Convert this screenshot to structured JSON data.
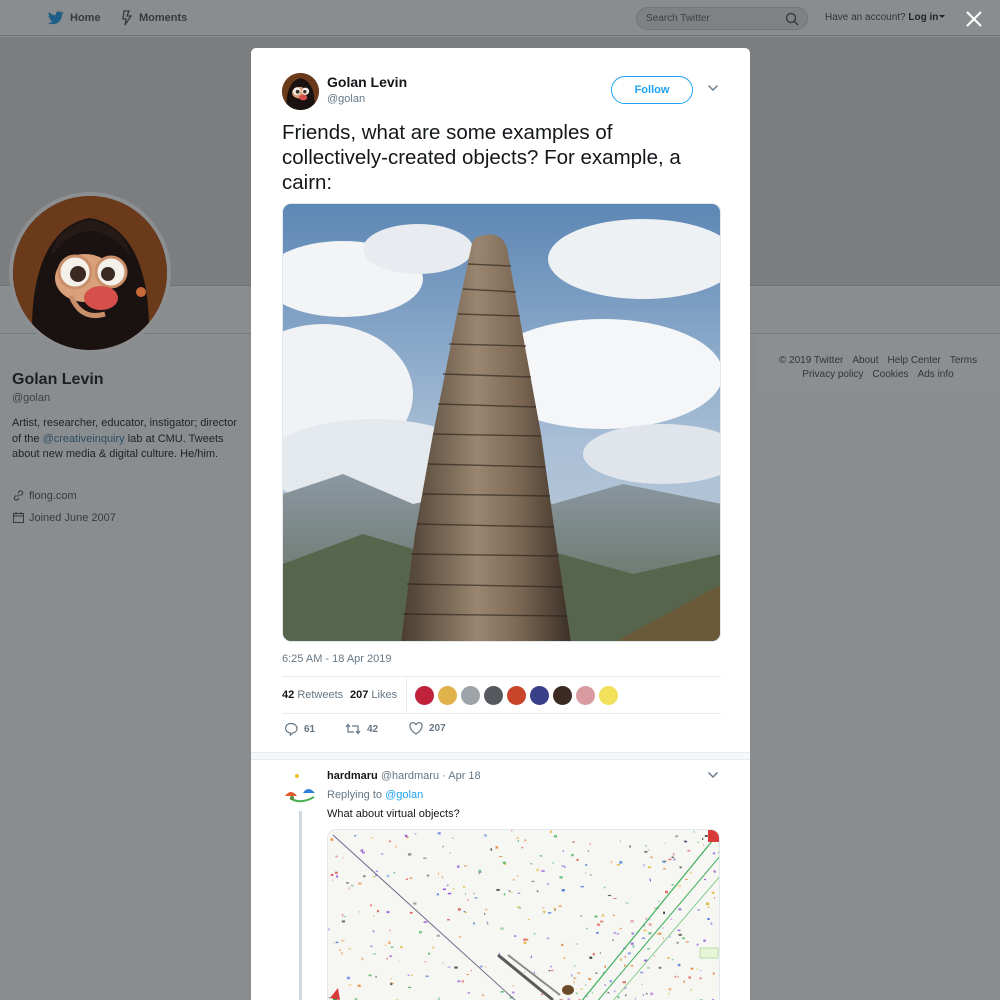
{
  "topnav": {
    "home_label": "Home",
    "moments_label": "Moments",
    "search_placeholder": "Search Twitter",
    "have_account": "Have an account?",
    "login_label": "Log in"
  },
  "profile": {
    "name": "Golan Levin",
    "handle": "@golan",
    "bio_prefix": "Artist, researcher, educator, instigator; director of the ",
    "bio_link": "@creativeinquiry",
    "bio_suffix": " lab at CMU. Tweets about new media & digital culture. He/him.",
    "url": "flong.com",
    "joined": "Joined June 2007"
  },
  "footer": {
    "row1": [
      "© 2019 Twitter",
      "About",
      "Help Center",
      "Terms"
    ],
    "row2": [
      "Privacy policy",
      "Cookies",
      "Ads info"
    ]
  },
  "tweet": {
    "author_name": "Golan Levin",
    "author_handle": "@golan",
    "follow_label": "Follow",
    "text": "Friends, what are some examples of collectively-created objects? For example, a cairn:",
    "timestamp": "6:25 AM - 18 Apr 2019",
    "retweets_count": "42",
    "retweets_label": "Retweets",
    "likes_count": "207",
    "likes_label": "Likes",
    "reply_count": "61",
    "retweet_action_count": "42",
    "like_action_count": "207",
    "liker_colors": [
      "#c0213b",
      "#e0b34a",
      "#9ea3a8",
      "#55595e",
      "#c8442a",
      "#3a3f8a",
      "#3b2a22",
      "#d99aa0",
      "#f3e05a"
    ]
  },
  "reply": {
    "name": "hardmaru",
    "handle": "@hardmaru",
    "date": "Apr 18",
    "replying_prefix": "Replying to",
    "replying_to": "@golan",
    "text": "What about virtual objects?"
  }
}
